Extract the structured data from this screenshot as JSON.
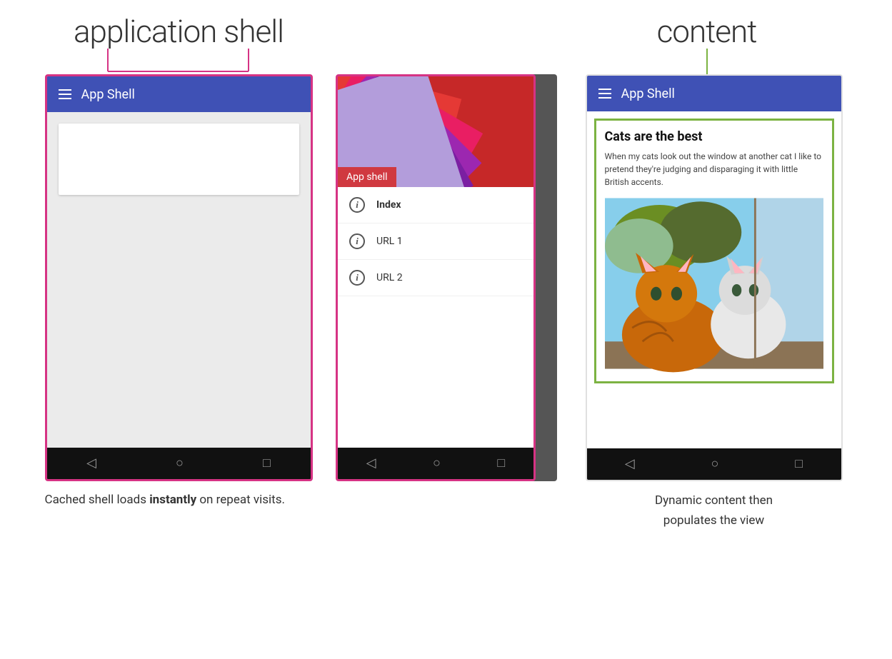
{
  "page": {
    "background": "#ffffff"
  },
  "labels": {
    "app_shell_label": "application shell",
    "content_label": "content"
  },
  "left_phone": {
    "titlebar_text": "App Shell",
    "border_color": "#d63384",
    "caption_part1": "Cached shell loads ",
    "caption_bold": "instantly",
    "caption_part2": " on repeat visits."
  },
  "middle_phone": {
    "app_shell_overlay_text": "App shell",
    "border_color": "#d63384",
    "drawer_items": [
      {
        "label": "Index",
        "bold": true
      },
      {
        "label": "URL 1",
        "bold": false
      },
      {
        "label": "URL 2",
        "bold": false
      }
    ]
  },
  "right_phone": {
    "titlebar_text": "App Shell",
    "border_color": "#7cb342",
    "content_title": "Cats are the best",
    "content_desc": "When my cats look out the window at another cat I like to pretend they're judging and disparaging it with little British accents.",
    "caption_line1": "Dynamic content then",
    "caption_line2": "populates the view"
  },
  "nav_icons": {
    "back": "◁",
    "home": "○",
    "square": "□"
  }
}
